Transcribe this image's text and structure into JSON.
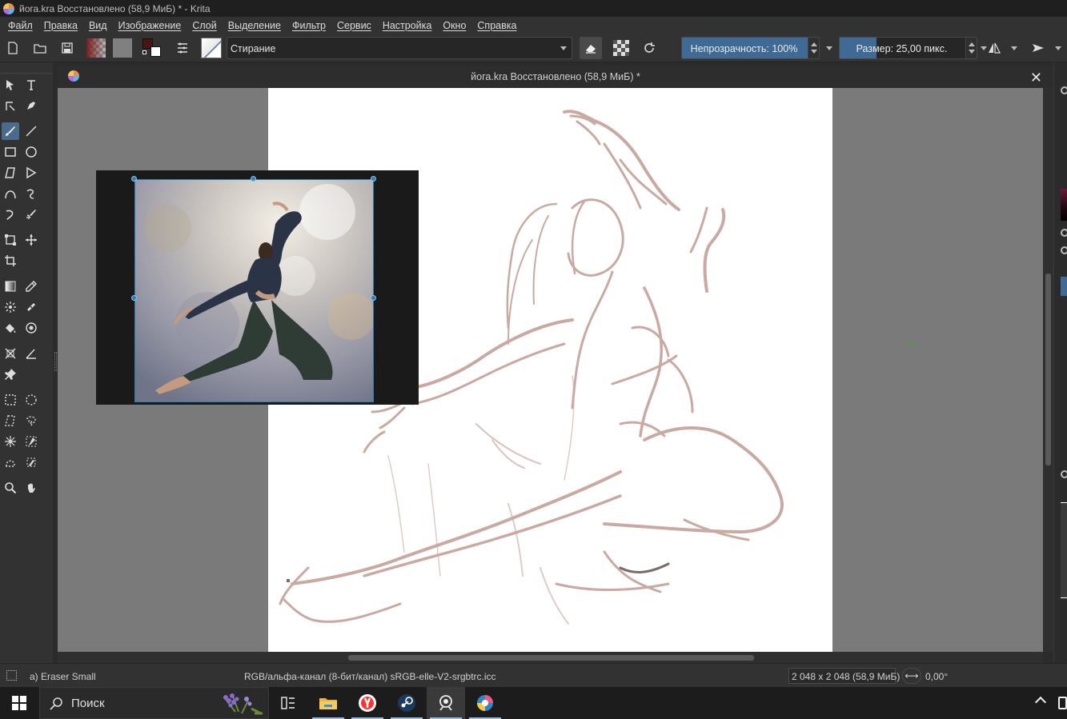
{
  "window": {
    "title": "йога.kra Восстановлено (58,9 МиБ) * - Krita"
  },
  "menu": [
    "Файл",
    "Правка",
    "Вид",
    "Изображение",
    "Слой",
    "Выделение",
    "Фильтр",
    "Сервис",
    "Настройка",
    "Окно",
    "Справка"
  ],
  "toolbar": {
    "brush_preset_name": "Стирание",
    "opacity_label": "Непрозрачность: 100%",
    "opacity_value": 100,
    "size_label": "Размер: 25,00 пикс.",
    "size_value": 25.0,
    "colors": {
      "foreground": "#4a1515",
      "background": "#ffffff",
      "accent": "#3f6a95"
    }
  },
  "document": {
    "tab_title": "йога.kra Восстановлено (58,9 МиБ) *",
    "close_glyph": "✕"
  },
  "status": {
    "brush": "a) Eraser Small",
    "color_space": "RGB/альфа-канал (8-бит/канал)  sRGB-elle-V2-srgbtrc.icc",
    "image_size": "2 048 x 2 048 (58,9 МиБ)",
    "rotation": "0,00°"
  },
  "taskbar": {
    "search_placeholder": "Поиск",
    "apps": [
      "task-view",
      "file-explorer",
      "yandex-browser",
      "steam",
      "screenshot-tool",
      "krita"
    ]
  },
  "sketch": {
    "stroke_color": "#c9aaa3"
  }
}
